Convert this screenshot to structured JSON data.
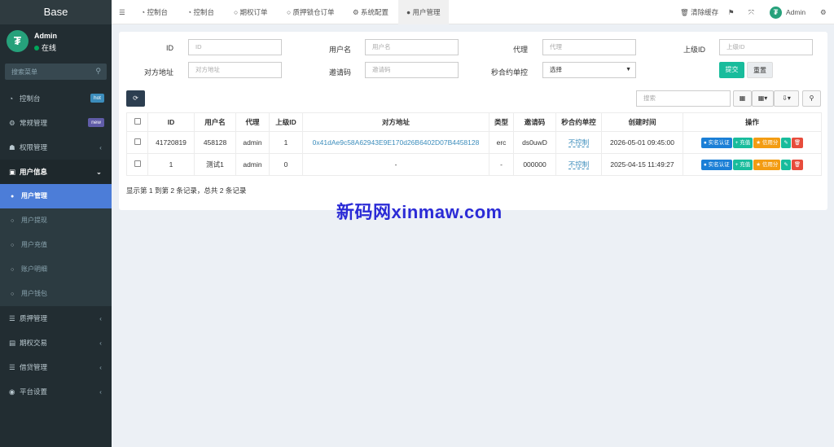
{
  "sidebar": {
    "logo": "Base",
    "user_name": "Admin",
    "user_status": "在线",
    "avatar_glyph": "₮",
    "search_placeholder": "搜索菜单",
    "items": [
      {
        "label": "控制台",
        "badge": "hot",
        "badge_color": "#3c8dbc"
      },
      {
        "label": "常规管理",
        "badge": "new",
        "badge_color": "#605ca8"
      },
      {
        "label": "权限管理"
      },
      {
        "label": "用户信息"
      },
      {
        "label": "用户管理"
      },
      {
        "label": "用户提现"
      },
      {
        "label": "用户充值"
      },
      {
        "label": "账户明细"
      },
      {
        "label": "用户钱包"
      },
      {
        "label": "质押管理"
      },
      {
        "label": "期权交易"
      },
      {
        "label": "借贷管理"
      },
      {
        "label": "平台设置"
      }
    ]
  },
  "topbar": {
    "tabs": [
      "控制台",
      "控制台",
      "期权订单",
      "质押锁仓订单",
      "系统配置",
      "用户管理"
    ],
    "clear_cache": "清除缓存",
    "admin_name": "Admin"
  },
  "filters": {
    "id_label": "ID",
    "id_placeholder": "ID",
    "username_label": "用户名",
    "username_placeholder": "用户名",
    "agent_label": "代理",
    "agent_placeholder": "代理",
    "parent_label": "上级ID",
    "parent_placeholder": "上级ID",
    "address_label": "对方地址",
    "address_placeholder": "对方地址",
    "invite_label": "邀请码",
    "invite_placeholder": "邀请码",
    "seconds_label": "秒合约单控",
    "seconds_value": "选择",
    "submit": "提交",
    "reset": "重置"
  },
  "toolbar": {
    "search_placeholder": "搜索"
  },
  "table": {
    "headers": [
      "ID",
      "用户名",
      "代理",
      "上级ID",
      "对方地址",
      "类型",
      "邀请码",
      "秒合约单控",
      "创建时间",
      "操作"
    ],
    "rows": [
      {
        "id": "41720819",
        "username": "458128",
        "agent": "admin",
        "parent": "1",
        "address": "0x41dAe9c58A62943E9E170d26B6402D07B4458128",
        "type": "erc",
        "invite": "ds0uwD",
        "control": "不控制",
        "created": "2026-05-01 09:45:00"
      },
      {
        "id": "1",
        "username": "测试1",
        "agent": "admin",
        "parent": "0",
        "address": "-",
        "type": "-",
        "invite": "000000",
        "control": "不控制",
        "created": "2025-04-15 11:49:27"
      }
    ],
    "actions": {
      "verify": "实名认证",
      "recharge": "充值",
      "credit": "信用分"
    }
  },
  "pagination": {
    "info": "显示第 1 到第 2 条记录，总共 2 条记录"
  },
  "watermark": "新码网xinmaw.com"
}
